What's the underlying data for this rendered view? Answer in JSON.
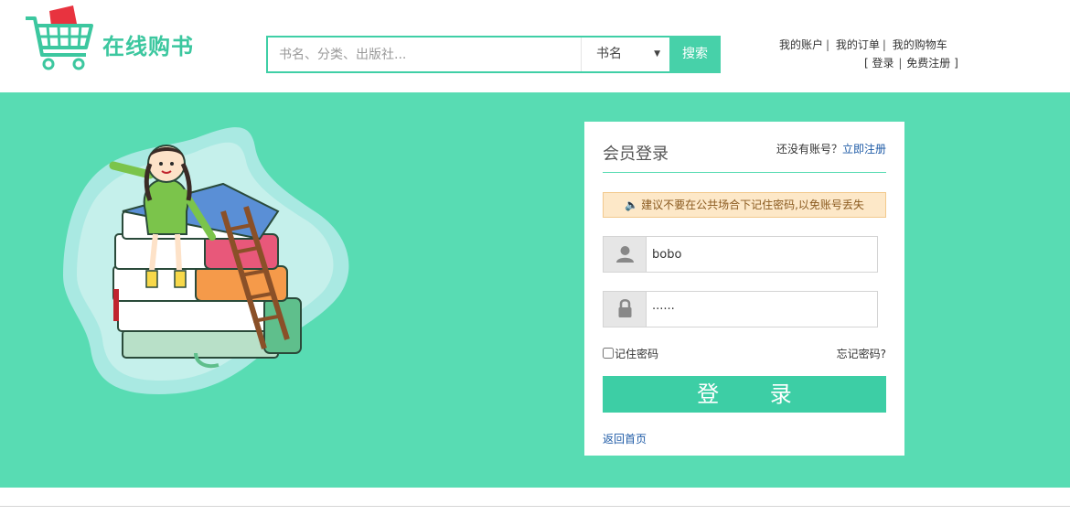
{
  "header": {
    "logo_text": "在线购书",
    "search": {
      "placeholder": "书名、分类、出版社...",
      "value": "",
      "selected_option": "书名",
      "button_label": "搜索"
    },
    "top_links": {
      "my_account": "我的账户",
      "my_orders": "我的订单",
      "my_cart": "我的购物车",
      "login": "登录",
      "register": "免费注册",
      "separator": "|",
      "bracket_open": "[",
      "bracket_close": "]"
    }
  },
  "login": {
    "title": "会员登录",
    "no_account": "还没有账号？",
    "register_link": "立即注册",
    "notice": "建议不要在公共场合下记住密码,以免账号丢失",
    "username": "bobo",
    "password": "······",
    "remember_label": "记住密码",
    "forgot_label": "忘记密码?",
    "login_button": "登 录",
    "back_home": "返回首页"
  },
  "colors": {
    "accent": "#58dcb3",
    "button": "#3dcea5",
    "logo": "#3cc79f",
    "link": "#1d5aa6",
    "notice_bg": "#fde8c8"
  },
  "icons": {
    "user": "user-icon",
    "lock": "lock-icon",
    "speaker": "speaker-icon",
    "cart": "shopping-cart-icon"
  }
}
